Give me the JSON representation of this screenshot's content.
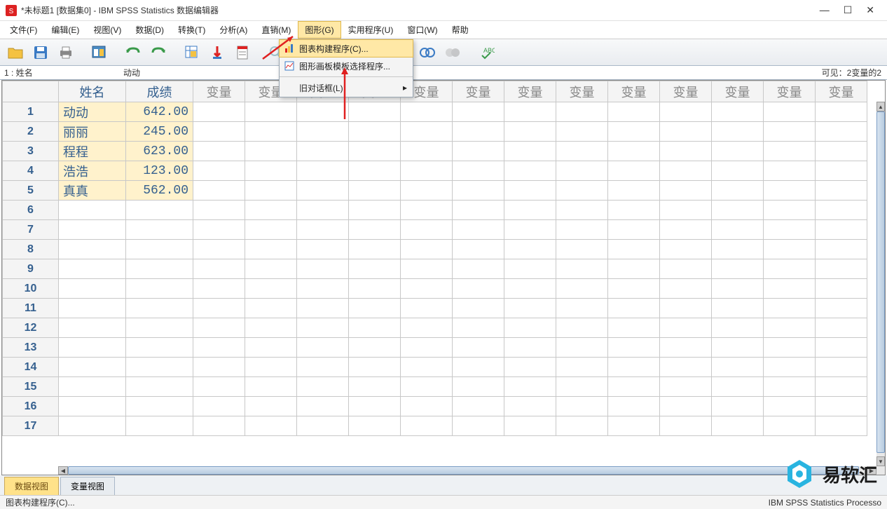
{
  "window": {
    "title": "*未标题1 [数据集0] - IBM SPSS Statistics 数据编辑器"
  },
  "menu": {
    "items": [
      "文件(F)",
      "编辑(E)",
      "视图(V)",
      "数据(D)",
      "转换(T)",
      "分析(A)",
      "直销(M)",
      "图形(G)",
      "实用程序(U)",
      "窗口(W)",
      "帮助"
    ],
    "highlight_index": 7
  },
  "dropdown": {
    "items": [
      {
        "icon": "chart-bar",
        "label": "图表构建程序(C)...",
        "hover": true
      },
      {
        "icon": "chart-template",
        "label": "图形画板模板选择程序...",
        "hover": false
      }
    ],
    "submenu_label": "旧对话框(L)"
  },
  "cellref": {
    "label": "1 : 姓名",
    "value": "动动",
    "visible": "可见：2变量的2"
  },
  "columns": [
    "姓名",
    "成绩",
    "变量",
    "变量",
    "变量",
    "变量",
    "变量",
    "变量",
    "变量",
    "变量",
    "变量",
    "变量",
    "变量",
    "变量",
    "变量"
  ],
  "filled_col_count": 2,
  "rows": [
    {
      "num": "1",
      "name": "动动",
      "score": "642.00"
    },
    {
      "num": "2",
      "name": "丽丽",
      "score": "245.00"
    },
    {
      "num": "3",
      "name": "程程",
      "score": "623.00"
    },
    {
      "num": "4",
      "name": "浩浩",
      "score": "123.00"
    },
    {
      "num": "5",
      "name": "真真",
      "score": "562.00"
    },
    {
      "num": "6",
      "name": "",
      "score": ""
    },
    {
      "num": "7",
      "name": "",
      "score": ""
    },
    {
      "num": "8",
      "name": "",
      "score": ""
    },
    {
      "num": "9",
      "name": "",
      "score": ""
    },
    {
      "num": "10",
      "name": "",
      "score": ""
    },
    {
      "num": "11",
      "name": "",
      "score": ""
    },
    {
      "num": "12",
      "name": "",
      "score": ""
    },
    {
      "num": "13",
      "name": "",
      "score": ""
    },
    {
      "num": "14",
      "name": "",
      "score": ""
    },
    {
      "num": "15",
      "name": "",
      "score": ""
    },
    {
      "num": "16",
      "name": "",
      "score": ""
    },
    {
      "num": "17",
      "name": "",
      "score": ""
    }
  ],
  "tabs": {
    "data_view": "数据视图",
    "var_view": "变量视图",
    "active": 0
  },
  "status": {
    "left": "图表构建程序(C)...",
    "right": "IBM SPSS Statistics Processo"
  },
  "watermark": {
    "text": "易软汇"
  }
}
